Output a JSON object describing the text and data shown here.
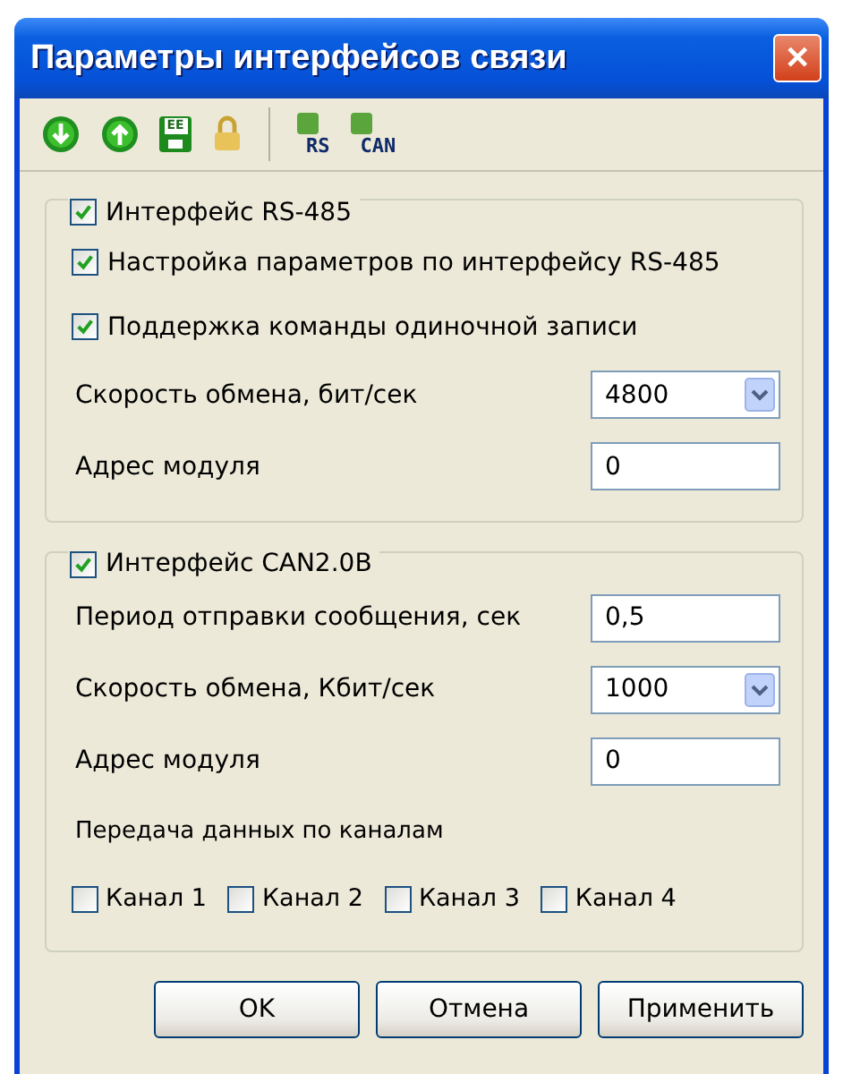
{
  "window": {
    "title": "Параметры интерфейсов связи",
    "close": "✕"
  },
  "toolbar": [
    {
      "kind": "down"
    },
    {
      "kind": "up"
    },
    {
      "kind": "save",
      "label": "EE"
    },
    {
      "kind": "lock"
    },
    {
      "kind": "separator"
    },
    {
      "kind": "port",
      "label": "RS"
    },
    {
      "kind": "port",
      "label": "CAN"
    }
  ],
  "groups": [
    {
      "header": {
        "label": "Интерфейс RS-485",
        "checked": true
      },
      "rows": [
        {
          "kind": "checkbox",
          "label": "Настройка параметров по интерфейсу RS-485",
          "checked": true
        },
        {
          "kind": "checkbox",
          "label": "Поддержка команды одиночной записи",
          "checked": true
        },
        {
          "kind": "select",
          "label": "Скорость обмена, бит/сек",
          "value": "4800"
        },
        {
          "kind": "input",
          "label": "Адрес модуля",
          "value": "0"
        }
      ]
    },
    {
      "header": {
        "label": "Интерфейс CAN2.0B",
        "checked": true
      },
      "rows": [
        {
          "kind": "input",
          "label": "Период отправки сообщения, сек",
          "value": "0,5"
        },
        {
          "kind": "select",
          "label": "Скорость обмена, Кбит/сек",
          "value": "1000"
        },
        {
          "kind": "input",
          "label": "Адрес модуля",
          "value": "0"
        },
        {
          "kind": "text",
          "label": "Передача данных по каналам"
        },
        {
          "kind": "checkboxes",
          "items": [
            {
              "label": "Канал 1",
              "checked": false
            },
            {
              "label": "Канал 2",
              "checked": false
            },
            {
              "label": "Канал 3",
              "checked": false
            },
            {
              "label": "Канал 4",
              "checked": false
            }
          ]
        }
      ]
    }
  ],
  "buttons": [
    {
      "label": "OK"
    },
    {
      "label": "Отмена"
    },
    {
      "label": "Применить"
    }
  ]
}
